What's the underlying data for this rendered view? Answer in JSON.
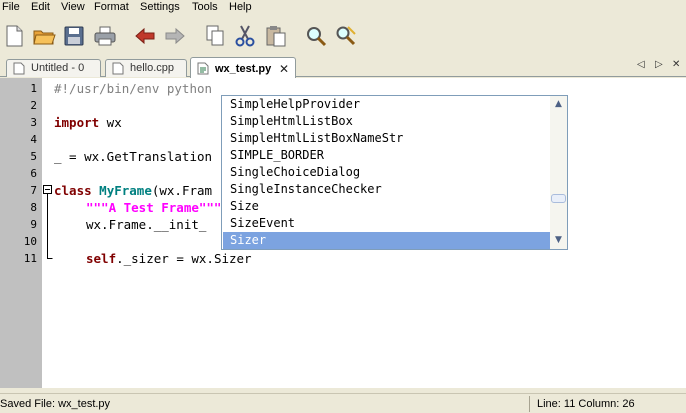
{
  "menubar": {
    "items": [
      "File",
      "Edit",
      "View",
      "Format",
      "Settings",
      "Tools",
      "Help"
    ]
  },
  "toolbar": {
    "buttons": [
      {
        "icon": "new-file-icon"
      },
      {
        "icon": "open-folder-icon"
      },
      {
        "icon": "save-icon"
      },
      {
        "icon": "print-icon"
      },
      {
        "icon": "undo-icon"
      },
      {
        "icon": "redo-icon"
      },
      {
        "icon": "copy-icon"
      },
      {
        "icon": "cut-icon"
      },
      {
        "icon": "paste-icon"
      },
      {
        "icon": "find-icon"
      },
      {
        "icon": "find-replace-icon"
      }
    ]
  },
  "tabs": [
    {
      "label": "Untitled - 0",
      "icon": "document-icon",
      "active": false
    },
    {
      "label": "hello.cpp",
      "icon": "document-icon",
      "active": false
    },
    {
      "label": "wx_test.py",
      "icon": "document-icon",
      "active": true,
      "close": "✕"
    }
  ],
  "tab_nav": {
    "prev": "◁",
    "next": "▷",
    "close": "✕"
  },
  "editor": {
    "line_numbers": [
      "1",
      "2",
      "3",
      "4",
      "5",
      "6",
      "7",
      "8",
      "9",
      "10",
      "11"
    ],
    "lines": {
      "l1": "#!/usr/bin/env python",
      "l3_kw": "import",
      "l3_rest": " wx",
      "l5": "_ = wx.GetTranslation",
      "l7_kw": "class",
      "l7_cls": "MyFrame",
      "l7_rest": "(wx.Fram",
      "l8_str": "\"\"\"A Test Frame\"\"\"",
      "l9": "wx.Frame.__init_",
      "l11_kw": "self",
      "l11_rest": "._sizer = wx.Sizer"
    }
  },
  "autocomplete": {
    "items": [
      "SimpleHelpProvider",
      "SimpleHtmlListBox",
      "SimpleHtmlListBoxNameStr",
      "SIMPLE_BORDER",
      "SingleChoiceDialog",
      "SingleInstanceChecker",
      "Size",
      "SizeEvent",
      "Sizer"
    ],
    "selected": "Sizer"
  },
  "statusbar": {
    "file": "Saved File: wx_test.py",
    "position": "Line: 11  Column: 26"
  },
  "colors": {
    "keyword": "#800000",
    "class_name": "#008080",
    "string": "#ff00ff",
    "comment": "#808080",
    "selection": "#7ca3e0"
  }
}
